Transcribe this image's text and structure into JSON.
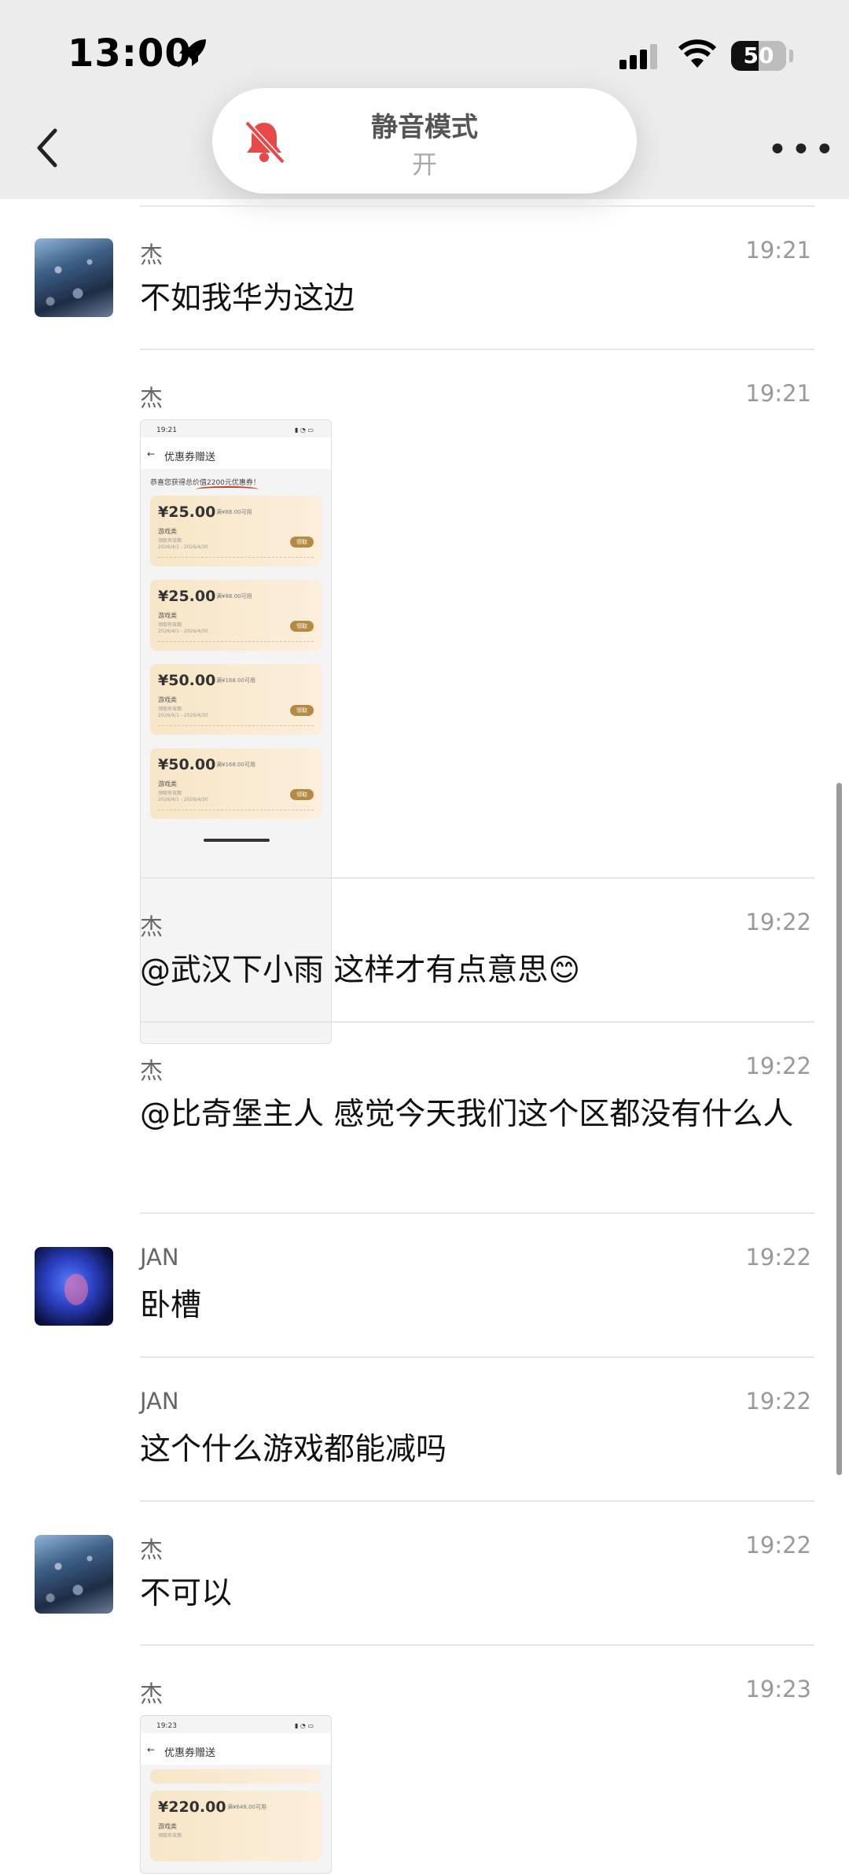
{
  "status_bar": {
    "time": "13:00",
    "battery": "50"
  },
  "nav": {
    "more": "•••"
  },
  "silent_mode": {
    "title": "静音模式",
    "state": "开"
  },
  "messages": [
    {
      "sender": "杰",
      "time": "19:21",
      "text": "不如我华为这边"
    },
    {
      "sender": "杰",
      "time": "19:21",
      "image": {
        "status_time": "19:21",
        "title": "优惠券赠送",
        "congrats": "恭喜您获得总价值2200元优惠券！",
        "coupons": [
          {
            "amount": "¥25.00",
            "condition": "满¥88.00可用",
            "category": "游戏类",
            "subtitle": "领取有效期",
            "dates": "2026/4/1 - 2026/4/30",
            "button": "领取"
          },
          {
            "amount": "¥25.00",
            "condition": "满¥88.00可用",
            "category": "游戏类",
            "subtitle": "领取有效期",
            "dates": "2026/4/1 - 2026/4/30",
            "button": "领取"
          },
          {
            "amount": "¥50.00",
            "condition": "满¥168.00可用",
            "category": "游戏类",
            "subtitle": "领取有效期",
            "dates": "2026/4/1 - 2026/4/30",
            "button": "领取"
          },
          {
            "amount": "¥50.00",
            "condition": "满¥168.00可用",
            "category": "游戏类",
            "subtitle": "领取有效期",
            "dates": "2026/4/1 - 2026/4/30",
            "button": "领取"
          }
        ]
      }
    },
    {
      "sender": "杰",
      "time": "19:22",
      "text": "@武汉下小雨 这样才有点意思😊"
    },
    {
      "sender": "杰",
      "time": "19:22",
      "text": "@比奇堡主人 感觉今天我们这个区都没有什么人"
    },
    {
      "sender": "JAN",
      "time": "19:22",
      "text": "卧槽"
    },
    {
      "sender": "JAN",
      "time": "19:22",
      "text": "这个什么游戏都能减吗"
    },
    {
      "sender": "杰",
      "time": "19:22",
      "text": "不可以"
    },
    {
      "sender": "杰",
      "time": "19:23",
      "image": {
        "status_time": "19:23",
        "title": "优惠券赠送",
        "coupons": [
          {
            "amount": "¥220.00",
            "condition": "满¥648.00可用",
            "category": "游戏类",
            "subtitle": "领取有效期"
          }
        ]
      }
    }
  ]
}
